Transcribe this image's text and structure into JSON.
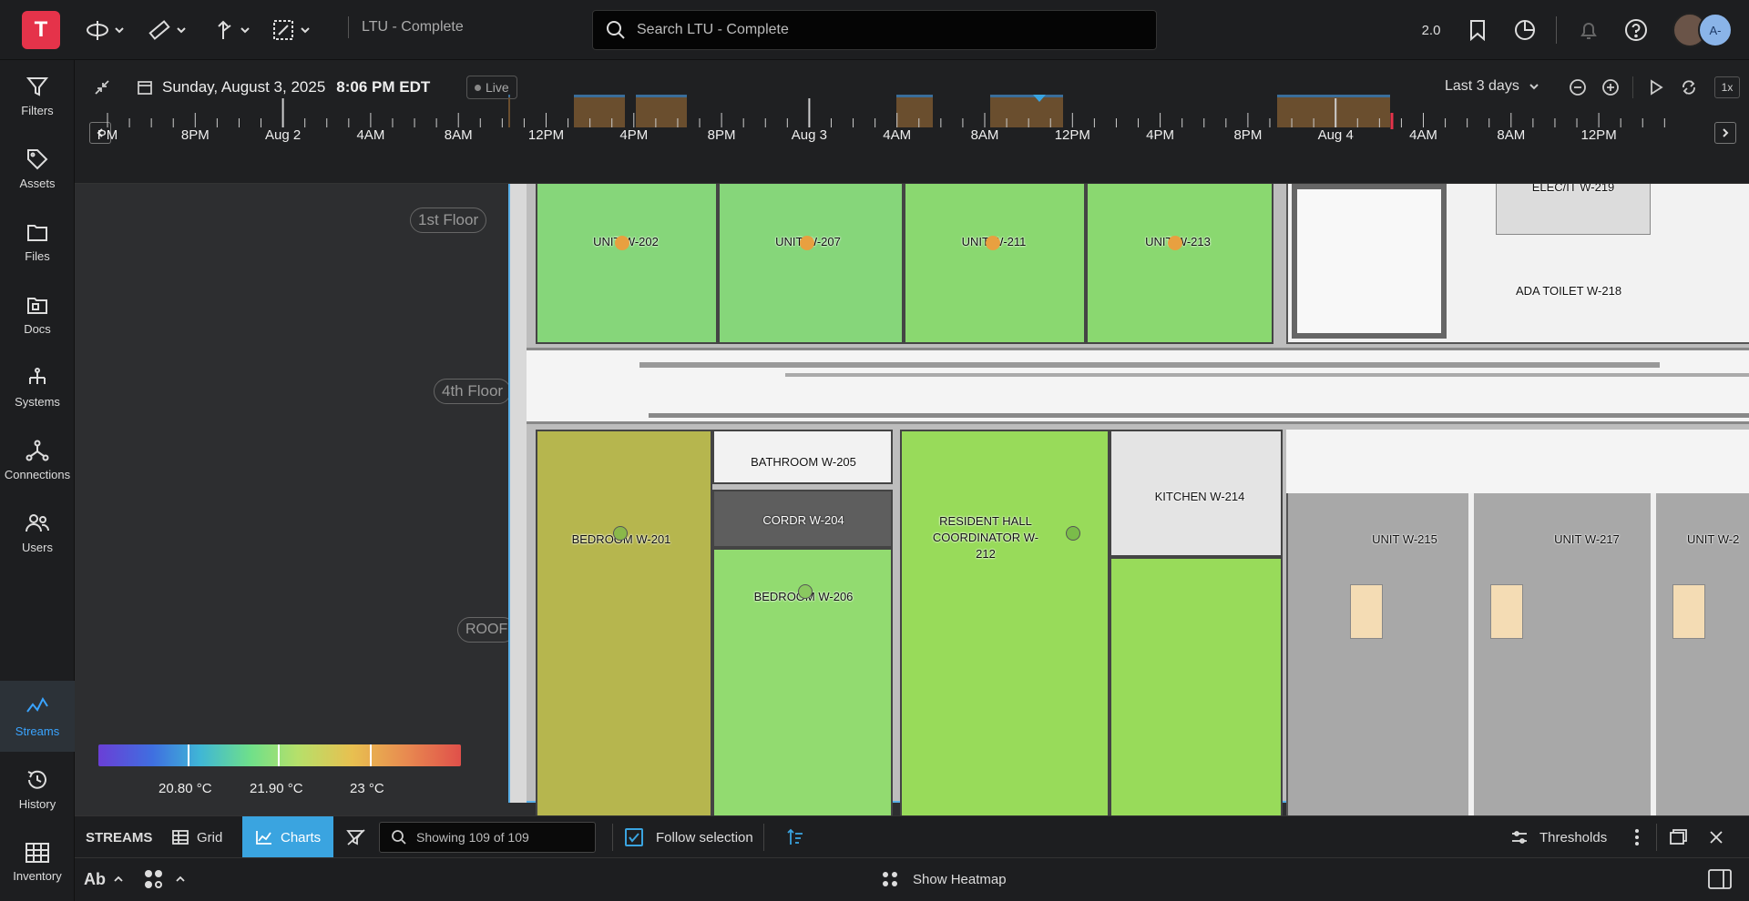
{
  "app": {
    "logo_letter": "T",
    "project": "LTU - Complete"
  },
  "search": {
    "placeholder": "Search LTU - Complete"
  },
  "topright": {
    "version": "2.0",
    "avatar_initials": "A-"
  },
  "sidebar": {
    "items": [
      {
        "label": "Filters",
        "icon": "filter-icon"
      },
      {
        "label": "Assets",
        "icon": "tag-icon"
      },
      {
        "label": "Files",
        "icon": "folder-icon"
      },
      {
        "label": "Docs",
        "icon": "docs-folder-icon"
      },
      {
        "label": "Systems",
        "icon": "hierarchy-icon"
      },
      {
        "label": "Connections",
        "icon": "network-icon"
      },
      {
        "label": "Users",
        "icon": "users-icon"
      },
      {
        "label": "Streams",
        "icon": "pulse-icon"
      },
      {
        "label": "History",
        "icon": "history-icon"
      },
      {
        "label": "Inventory",
        "icon": "inventory-icon"
      }
    ]
  },
  "timebar": {
    "date": "Sunday, August 3, 2025",
    "time": "8:06 PM EDT",
    "live_label": "Live",
    "range": "Last 3 days",
    "speed": "1x",
    "tick_labels": [
      "PM",
      "8PM",
      "Aug 2",
      "4AM",
      "8AM",
      "12PM",
      "4PM",
      "8PM",
      "Aug 3",
      "4AM",
      "8AM",
      "12PM",
      "4PM",
      "8PM",
      "Aug 4",
      "4AM",
      "8AM",
      "12PM"
    ]
  },
  "floors": {
    "first": "1st Floor",
    "fourth": "4th Floor",
    "roof": "ROOF"
  },
  "rooms": {
    "unit202": "UNIT W-202",
    "unit207": "UNIT W-207",
    "unit211": "UNIT W-211",
    "unit213": "UNIT W-213",
    "elec": "ELEC/IT W-219",
    "ada": "ADA TOILET W-218",
    "bath205": "BATHROOM W-205",
    "cordr204": "CORDR W-204",
    "bed201": "BEDROOM W-201",
    "bed206": "BEDROOM W-206",
    "rhc212": "RESIDENT HALL COORDINATOR W-212",
    "kitchen214": "KITCHEN W-214",
    "unit215": "UNIT W-215",
    "unit217": "UNIT W-217",
    "unit2xx": "UNIT W-2"
  },
  "legend": {
    "low": "20.80 °C",
    "mid": "21.90 °C",
    "high": "23 °C"
  },
  "streams_bar": {
    "title": "STREAMS",
    "grid": "Grid",
    "charts": "Charts",
    "search_placeholder": "Showing 109 of 109",
    "follow": "Follow selection",
    "thresholds": "Thresholds"
  },
  "bottom_bar": {
    "text_style": "Ab",
    "heatmap": "Show Heatmap"
  },
  "colors": {
    "accent": "#3aa4e0",
    "brand": "#e5334a"
  }
}
